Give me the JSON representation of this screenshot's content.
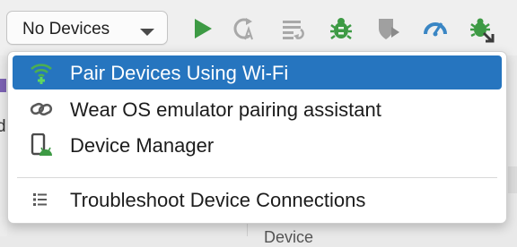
{
  "toolbar": {
    "device_selector": {
      "value": "No Devices"
    },
    "icons": [
      {
        "name": "run-icon",
        "color": "#3d9a44"
      },
      {
        "name": "apply-changes-restart-icon",
        "color": "#a0a0a0"
      },
      {
        "name": "apply-code-changes-icon",
        "color": "#a0a0a0"
      },
      {
        "name": "debug-icon",
        "color": "#3d9a44"
      },
      {
        "name": "coverage-icon",
        "color": "#a0a0a0"
      },
      {
        "name": "profiler-icon",
        "color": "#3a86c4"
      },
      {
        "name": "attach-debugger-icon",
        "color": "#3d9a44"
      }
    ]
  },
  "menu": {
    "items": [
      {
        "icon": "wifi-add-icon",
        "label": "Pair Devices Using Wi-Fi",
        "selected": true
      },
      {
        "icon": "link-icon",
        "label": "Wear OS emulator pairing assistant",
        "selected": false
      },
      {
        "icon": "device-manager-icon",
        "label": "Device Manager",
        "selected": false
      },
      {
        "icon": "list-icon",
        "label": "Troubleshoot Device Connections",
        "selected": false
      }
    ]
  },
  "background": {
    "partial_char": "d",
    "partial_label": "Device"
  },
  "colors": {
    "selection": "#2675bf",
    "green": "#3d9a44",
    "blue": "#3a86c4",
    "gray_icon": "#a0a0a0"
  }
}
